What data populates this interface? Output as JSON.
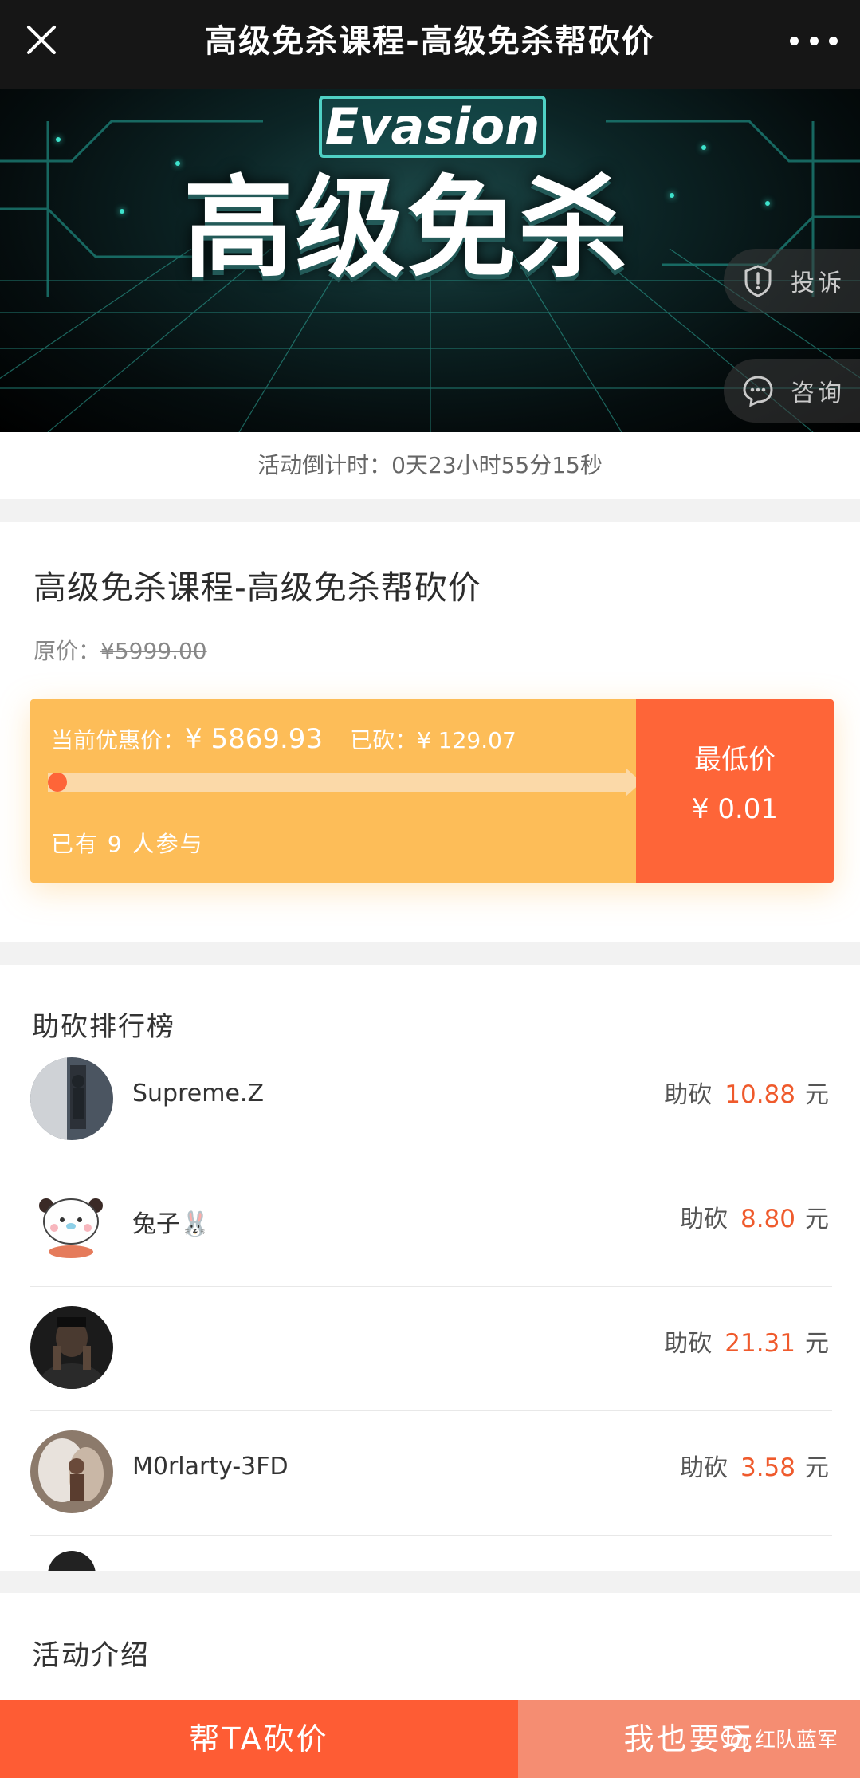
{
  "topbar": {
    "title": "高级免杀课程-高级免杀帮砍价",
    "close_icon": "close-icon",
    "more_icon": "more-dots-icon"
  },
  "banner": {
    "label": "Evasion",
    "title": "高级免杀",
    "report_label": "投诉",
    "consult_label": "咨询"
  },
  "countdown": {
    "text": "活动倒计时：0天23小时55分15秒"
  },
  "product": {
    "title": "高级免杀课程-高级免杀帮砍价",
    "original_price_label": "原价：",
    "original_price": "¥5999.00",
    "current_label": "当前优惠价：",
    "current_price": "¥ 5869.93",
    "cut_label": "已砍：",
    "cut_amount": "¥ 129.07",
    "participants": "已有 9 人参与",
    "min_label": "最低价",
    "min_price": "¥ 0.01",
    "progress_fraction": 0.0215
  },
  "ranking": {
    "title": "助砍排行榜",
    "help_prefix": "助砍",
    "unit": "元",
    "rows": [
      {
        "name": "Supreme.Z",
        "amount": "10.88"
      },
      {
        "name": "兔子🐰",
        "amount": "8.80"
      },
      {
        "name": "",
        "amount": "21.31"
      },
      {
        "name": "M0rlarty-3FD",
        "amount": "3.58"
      }
    ]
  },
  "intro": {
    "title": "活动介绍"
  },
  "bottom": {
    "help_button": "帮TA砍价",
    "want_button": "我也要玩"
  },
  "watermark": {
    "text": "红队蓝军"
  },
  "colors": {
    "accent": "#fe5c34",
    "progress_bg": "#fdbd58",
    "amount": "#ef5a2c"
  }
}
